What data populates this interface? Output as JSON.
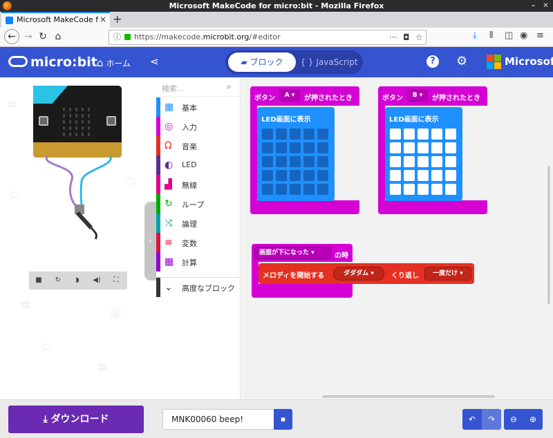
{
  "window": {
    "title": "Microsoft MakeCode for micro:bit - Mozilla Firefox"
  },
  "browser": {
    "tab_title": "Microsoft MakeCode for m",
    "tab_close": "×",
    "new_tab": "+",
    "url_prefix": "https://makecode.",
    "url_domain": "microbit.org",
    "url_suffix": "/#editor",
    "url_more": "···"
  },
  "header": {
    "logo_text": "micro:bit",
    "home_label": "ホーム",
    "blocks_tab": "ブロック",
    "js_tab": "JavaScript",
    "help": "?",
    "brand": "Microsoft",
    "brand_colors": [
      "#f25022",
      "#7fba00",
      "#00a4ef",
      "#ffb900"
    ],
    "accent": "#3454d1"
  },
  "toolbox": {
    "search_placeholder": "検索...",
    "categories": [
      {
        "label": "基本",
        "color": "#1e90ff",
        "icon": "grid-icon"
      },
      {
        "label": "入力",
        "color": "#d400d4",
        "icon": "target-icon"
      },
      {
        "label": "音楽",
        "color": "#e63022",
        "icon": "headphones-icon"
      },
      {
        "label": "LED",
        "color": "#5c2d91",
        "icon": "toggle-icon"
      },
      {
        "label": "無線",
        "color": "#e3008c",
        "icon": "signal-icon"
      },
      {
        "label": "ループ",
        "color": "#00aa00",
        "icon": "loop-icon"
      },
      {
        "label": "論理",
        "color": "#00a4a6",
        "icon": "shuffle-icon"
      },
      {
        "label": "変数",
        "color": "#dc143c",
        "icon": "lines-icon"
      },
      {
        "label": "計算",
        "color": "#9400d3",
        "icon": "calculator-icon"
      },
      {
        "label": "高度なブロック",
        "color": "#333333",
        "icon": "chevron-down-icon"
      }
    ]
  },
  "workspace": {
    "block_a": {
      "prefix": "ボタン",
      "button": "A",
      "suffix": "が押されたとき",
      "inner": "LED画面に表示",
      "leds_on": false
    },
    "block_b": {
      "prefix": "ボタン",
      "button": "B",
      "suffix": "が押されたとき",
      "inner": "LED画面に表示",
      "leds_on": true
    },
    "block_gesture": {
      "gesture": "画面が下になった",
      "suffix": "の時",
      "melody_prefix": "メロディを開始する",
      "melody": "ダダダム",
      "repeat_label": "くり返し",
      "repeat_value": "一度だけ"
    }
  },
  "footer": {
    "download_label": "ダウンロード",
    "project_name": "MNK00060 beep!"
  }
}
